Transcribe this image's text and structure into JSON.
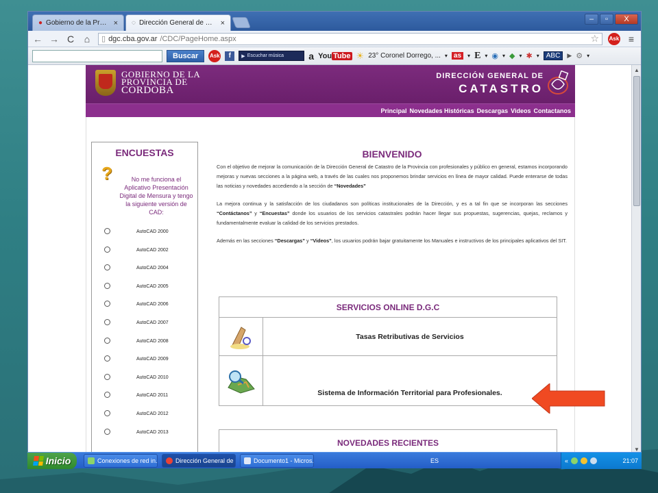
{
  "browser": {
    "tabs": [
      {
        "label": "Gobierno de la Provincia de C",
        "active": false
      },
      {
        "label": "Dirección General de Catastr",
        "active": true
      }
    ],
    "url_host": "dgc.cba.gov.ar",
    "url_path": "/CDC/PageHome.aspx",
    "window_buttons": [
      "–",
      "▫",
      "X"
    ]
  },
  "toolbar": {
    "search_button": "Buscar",
    "music_label": "Escuchar música",
    "youtube_you": "You",
    "youtube_tube": "Tube",
    "weather": "23° Coronel Dorrego, ...",
    "abc": "ABC",
    "as": "as",
    "e": "E"
  },
  "site": {
    "logo_line1": "GOBIERNO DE LA",
    "logo_line2": "PROVINCIA DE",
    "logo_line3": "CORDOBA",
    "brand_line1": "DIRECCIÓN GENERAL DE",
    "brand_line2": "CATASTRO",
    "nav": [
      "Principal",
      "Novedades Históricas",
      "Descargas",
      "Videos",
      "Contactanos"
    ]
  },
  "sidebar": {
    "title": "ENCUESTAS",
    "question": "No me funciona el Aplicativo Presentación Digital de Mensura y tengo la siguiente versión de CAD:",
    "options": [
      "AutoCAD 2000",
      "AutoCAD 2002",
      "AutoCAD 2004",
      "AutoCAD 2005",
      "AutoCAD 2006",
      "AutoCAD 2007",
      "AutoCAD 2008",
      "AutoCAD 2009",
      "AutoCAD 2010",
      "AutoCAD 2011",
      "AutoCAD 2012",
      "AutoCAD 2013"
    ]
  },
  "main": {
    "title": "BIENVENIDO",
    "p1": "Con el objetivo de mejorar la comunicación de la Dirección General de Catastro de la Provincia con profesionales y público en general, estamos incorporando mejoras y nuevas secciones a la página web, a través de las cuales nos proponemos brindar servicios en línea de mayor calidad. Puede enterarse de todas las noticias y novedades accediendo a la sección de",
    "p1_bold": "“Novedades”",
    "p2_a": "La mejora continua y la satisfacción de los ciudadanos son políticas institucionales de la Dirección, y es a tal fin que se incorporan las secciones",
    "p2_b1": "“Contáctanos”",
    "p2_c": " y ",
    "p2_b2": "“Encuestas”",
    "p2_d": " donde los usuarios de los servicios catastrales podrán hacer llegar sus propuestas, sugerencias, quejas, reclamos y fundamentalmente evaluar la calidad de los servicios prestados.",
    "p3_a": "Además en las secciones ",
    "p3_b1": "“Descargas”",
    "p3_c": " y ",
    "p3_b2": "“Videos”",
    "p3_d": ", los usuarios podrán bajar gratuitamente los Manuales e instructivos de los principales aplicativos del SIT."
  },
  "services": {
    "title": "SERVICIOS ONLINE D.G.C",
    "items": [
      {
        "label": "Tasas Retributivas de Servicios"
      },
      {
        "label": "Sistema de Información Territorial para Profesionales."
      }
    ]
  },
  "novedades": {
    "title": "NOVEDADES RECIENTES"
  },
  "taskbar": {
    "start": "Inicio",
    "tasks": [
      {
        "label": "Conexiones de red in..."
      },
      {
        "label": "Dirección General de ..."
      },
      {
        "label": "Documento1 - Micros..."
      }
    ],
    "lang": "ES",
    "clock": "21:07"
  },
  "colors": {
    "brand_purple": "#7a2a7b",
    "arrow_red": "#f04a22",
    "desktop_teal": "#2f7f84"
  }
}
